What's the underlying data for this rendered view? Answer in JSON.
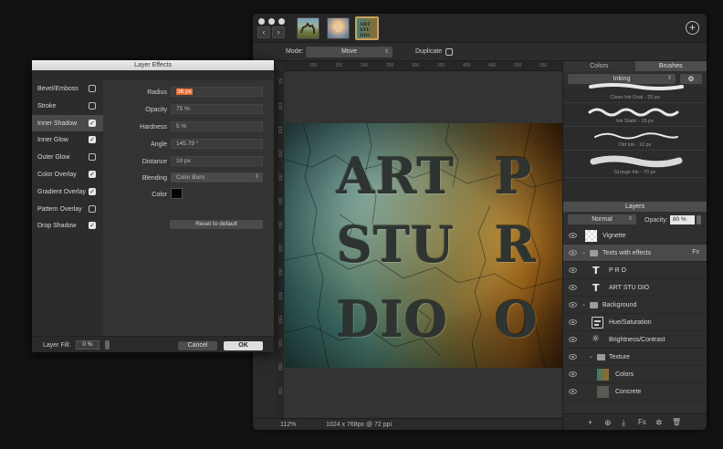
{
  "window": {
    "thumbnails": [
      "camel-photo",
      "portrait-photo",
      "art-studio-document"
    ],
    "plus_icon": "+",
    "nav_back": "‹",
    "nav_forward": "›"
  },
  "toolbar": {
    "mode_label": "Mode:",
    "mode_value": "Move",
    "duplicate_label": "Duplicate"
  },
  "ruler": {
    "top": [
      "100",
      "150",
      "200",
      "250",
      "300",
      "350",
      "400",
      "450",
      "500",
      "550",
      "600"
    ],
    "left": [
      "50",
      "100",
      "150",
      "200",
      "250",
      "300",
      "350",
      "400",
      "450",
      "500",
      "550",
      "600",
      "650",
      "700"
    ]
  },
  "artwork": {
    "row1": [
      "ART",
      "P"
    ],
    "row2": [
      "STU",
      "R"
    ],
    "row3": [
      "DIO",
      "O"
    ]
  },
  "status": {
    "zoom": "112%",
    "doc_info": "1024 x 768px @ 72 ppi"
  },
  "right_panel": {
    "tabs": [
      "Colors",
      "Brushes"
    ],
    "active_tab": "Brushes",
    "brush_category": "Inking",
    "brushes": [
      {
        "label": "Clean Ink Oval - 25 px"
      },
      {
        "label": "Ink Static - 15 px"
      },
      {
        "label": "Old Ink - 10 px"
      },
      {
        "label": "Grunge Ink - 70 px"
      }
    ],
    "layers_title": "Layers",
    "blend_mode": "Normal",
    "opacity_label": "Opacity:",
    "opacity_value": "80 %",
    "layers": [
      {
        "name": "Vignette",
        "kind": "checker"
      },
      {
        "name": "Texts with effects",
        "kind": "folder",
        "fx": "Fx"
      },
      {
        "name": "P R O",
        "kind": "text"
      },
      {
        "name": "ART STU DIO",
        "kind": "text"
      },
      {
        "name": "Background",
        "kind": "folder"
      },
      {
        "name": "Hue/Saturation",
        "kind": "adjust"
      },
      {
        "name": "Brightness/Contrast",
        "kind": "sun"
      },
      {
        "name": "Texture",
        "kind": "folder"
      },
      {
        "name": "Colors",
        "kind": "image-colors"
      },
      {
        "name": "Concrete",
        "kind": "image-concrete"
      }
    ],
    "bottom_icons": [
      "+",
      "⊕",
      "⤓",
      "Fx",
      "✲",
      "🗑"
    ]
  },
  "dialog": {
    "title": "Layer Effects",
    "effects": [
      {
        "name": "Bevel/Emboss",
        "checked": false
      },
      {
        "name": "Stroke",
        "checked": false
      },
      {
        "name": "Inner Shadow",
        "checked": true
      },
      {
        "name": "Inner Glow",
        "checked": true
      },
      {
        "name": "Outer Glow",
        "checked": false
      },
      {
        "name": "Color Overlay",
        "checked": true
      },
      {
        "name": "Gradient Overlay",
        "checked": true
      },
      {
        "name": "Pattern Overlay",
        "checked": false
      },
      {
        "name": "Drop Shadow",
        "checked": true
      }
    ],
    "selected_effect": "Inner Shadow",
    "params": {
      "radius_label": "Radius",
      "radius_value": "36 px",
      "opacity_label": "Opacity",
      "opacity_value": "75 %",
      "hardness_label": "Hardness",
      "hardness_value": "5 %",
      "angle_label": "Angle",
      "angle_value": "145.79 °",
      "distance_label": "Distance",
      "distance_value": "10 px",
      "blending_label": "Blending",
      "blending_value": "Color Burn",
      "color_label": "Color",
      "color_value": "#050505"
    },
    "reset_label": "Reset to default",
    "layer_fill_label": "Layer Fill:",
    "layer_fill_value": "0 %",
    "cancel_label": "Cancel",
    "ok_label": "OK"
  }
}
